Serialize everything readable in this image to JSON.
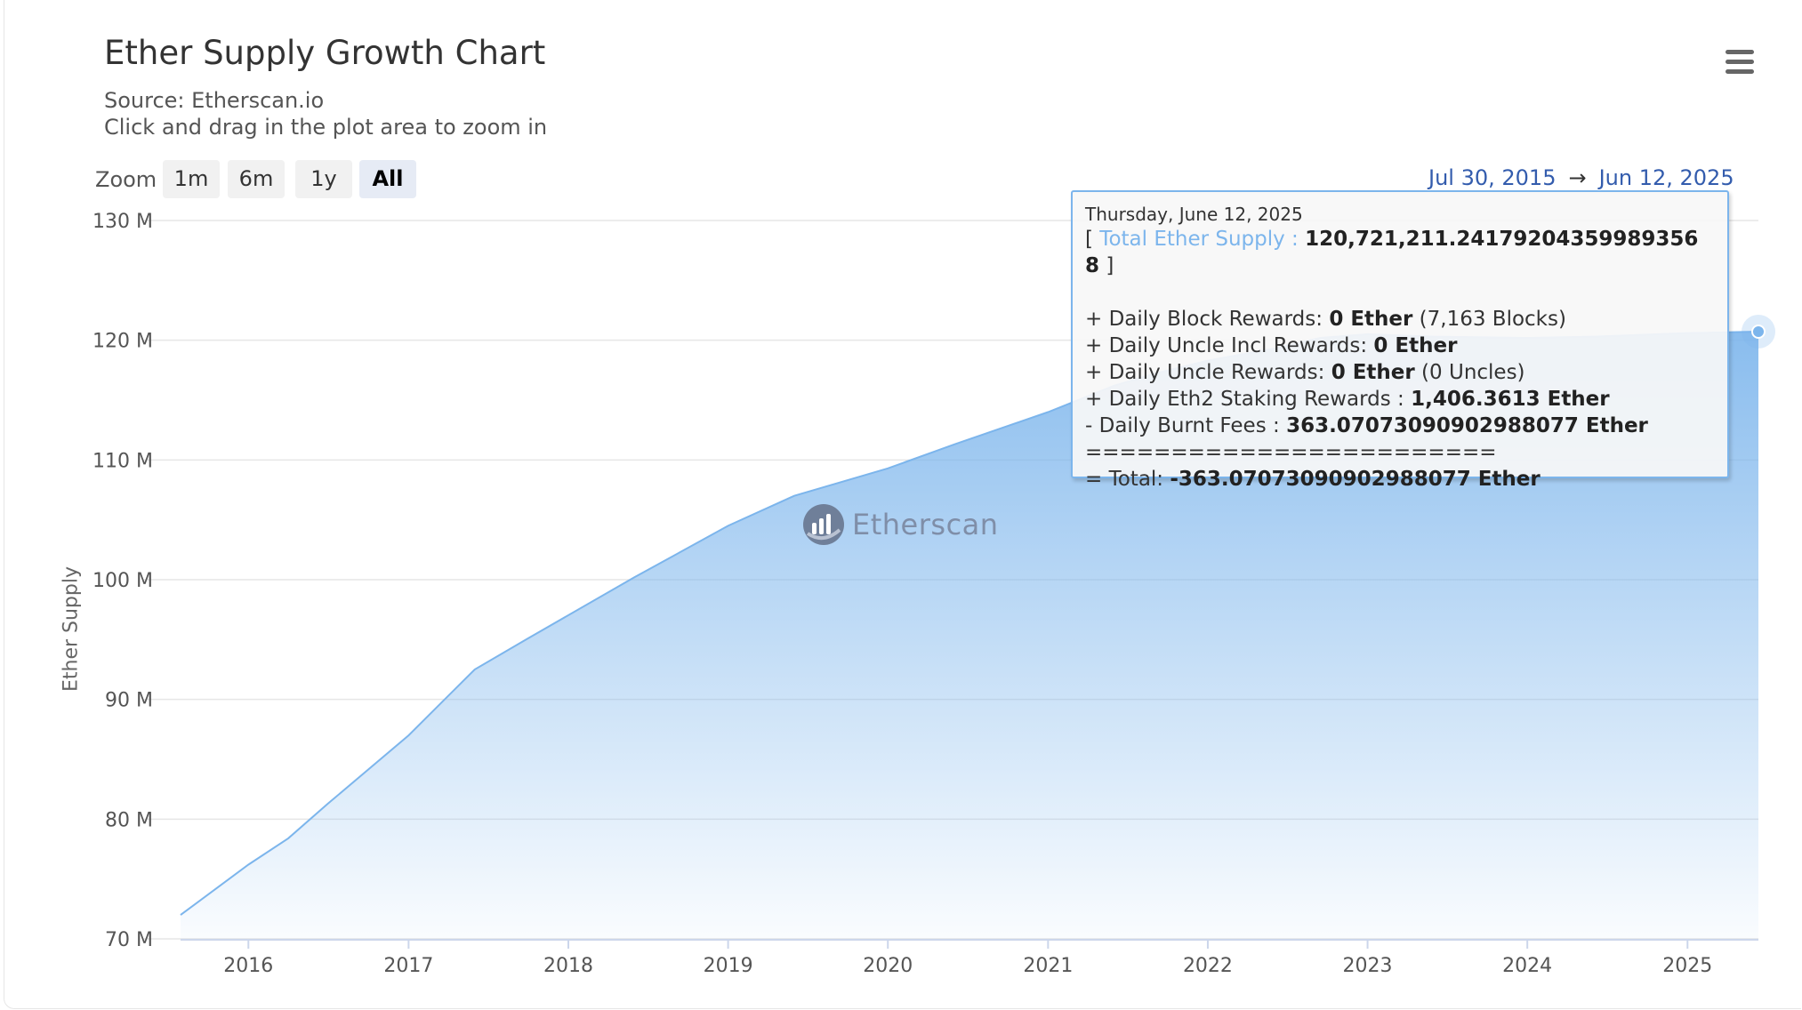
{
  "header": {
    "title": "Ether Supply Growth Chart",
    "source": "Source: Etherscan.io",
    "hint": "Click and drag in the plot area to zoom in"
  },
  "menu": {
    "icon": "hamburger-menu-icon"
  },
  "zoom": {
    "label": "Zoom",
    "buttons": [
      "1m",
      "6m",
      "1y",
      "All"
    ],
    "active": "All"
  },
  "range": {
    "from": "Jul 30, 2015",
    "arrow": "→",
    "to": "Jun 12, 2025"
  },
  "watermark": {
    "text": "Etherscan",
    "icon": "etherscan-logo-icon"
  },
  "tooltip": {
    "date": "Thursday, June 12, 2025",
    "open_bracket": "[",
    "series_name": "Total Ether Supply :",
    "series_value": "120,721,211.24179204359989356 8",
    "close_bracket": "]",
    "lines": [
      {
        "prefix": "+ Daily Block Rewards: ",
        "value": "0 Ether",
        "suffix": " (7,163 Blocks)"
      },
      {
        "prefix": "+ Daily Uncle Incl Rewards: ",
        "value": "0 Ether",
        "suffix": ""
      },
      {
        "prefix": "+ Daily Uncle Rewards: ",
        "value": "0 Ether",
        "suffix": " (0 Uncles)"
      },
      {
        "prefix": "+ Daily Eth2 Staking Rewards : ",
        "value": "1,406.3613 Ether",
        "suffix": ""
      },
      {
        "prefix": "- Daily Burnt Fees : ",
        "value": "363.07073090902988077 Ether",
        "suffix": ""
      }
    ],
    "separator": "========================",
    "total_prefix": "= Total: ",
    "total_value": "-363.07073090902988077 Ether"
  },
  "chart_data": {
    "type": "area",
    "title": "Ether Supply Growth Chart",
    "subtitle": "Source: Etherscan.io",
    "ylabel": "Ether Supply",
    "xlabel": "",
    "y_unit_suffix": " M",
    "ylim": [
      70,
      130
    ],
    "y_ticks": [
      70,
      80,
      90,
      100,
      110,
      120,
      130
    ],
    "y_tick_labels": [
      "70 M",
      "80 M",
      "90 M",
      "100 M",
      "110 M",
      "120 M",
      "130 M"
    ],
    "xlim": [
      "2015-07-30",
      "2025-06-12"
    ],
    "x_ticks": [
      "2016-01-01",
      "2017-01-01",
      "2018-01-01",
      "2019-01-01",
      "2020-01-01",
      "2021-01-01",
      "2022-01-01",
      "2023-01-01",
      "2024-01-01",
      "2025-01-01"
    ],
    "x_tick_labels": [
      "2016",
      "2017",
      "2018",
      "2019",
      "2020",
      "2021",
      "2022",
      "2023",
      "2024",
      "2025"
    ],
    "grid": true,
    "color": "#7cb5ec",
    "series": [
      {
        "name": "Total Ether Supply",
        "x": [
          "2015-07-30",
          "2016-01-01",
          "2016-04-01",
          "2016-07-01",
          "2017-01-01",
          "2017-06-01",
          "2017-10-01",
          "2018-06-01",
          "2019-01-01",
          "2019-06-01",
          "2020-01-01",
          "2020-06-01",
          "2021-01-01",
          "2021-06-01",
          "2021-09-01",
          "2022-01-01",
          "2022-06-01",
          "2022-09-15",
          "2023-01-01",
          "2023-06-01",
          "2024-01-01",
          "2024-06-01",
          "2025-01-01",
          "2025-06-12"
        ],
        "y": [
          72.0,
          76.2,
          78.4,
          81.3,
          87.0,
          92.5,
          95.1,
          100.2,
          104.5,
          107.0,
          109.3,
          111.3,
          114.0,
          116.2,
          117.2,
          118.3,
          119.3,
          120.2,
          120.5,
          120.3,
          120.2,
          120.3,
          120.6,
          120.72
        ]
      }
    ],
    "highlight": {
      "x": "2025-06-12",
      "y": 120.72
    }
  }
}
